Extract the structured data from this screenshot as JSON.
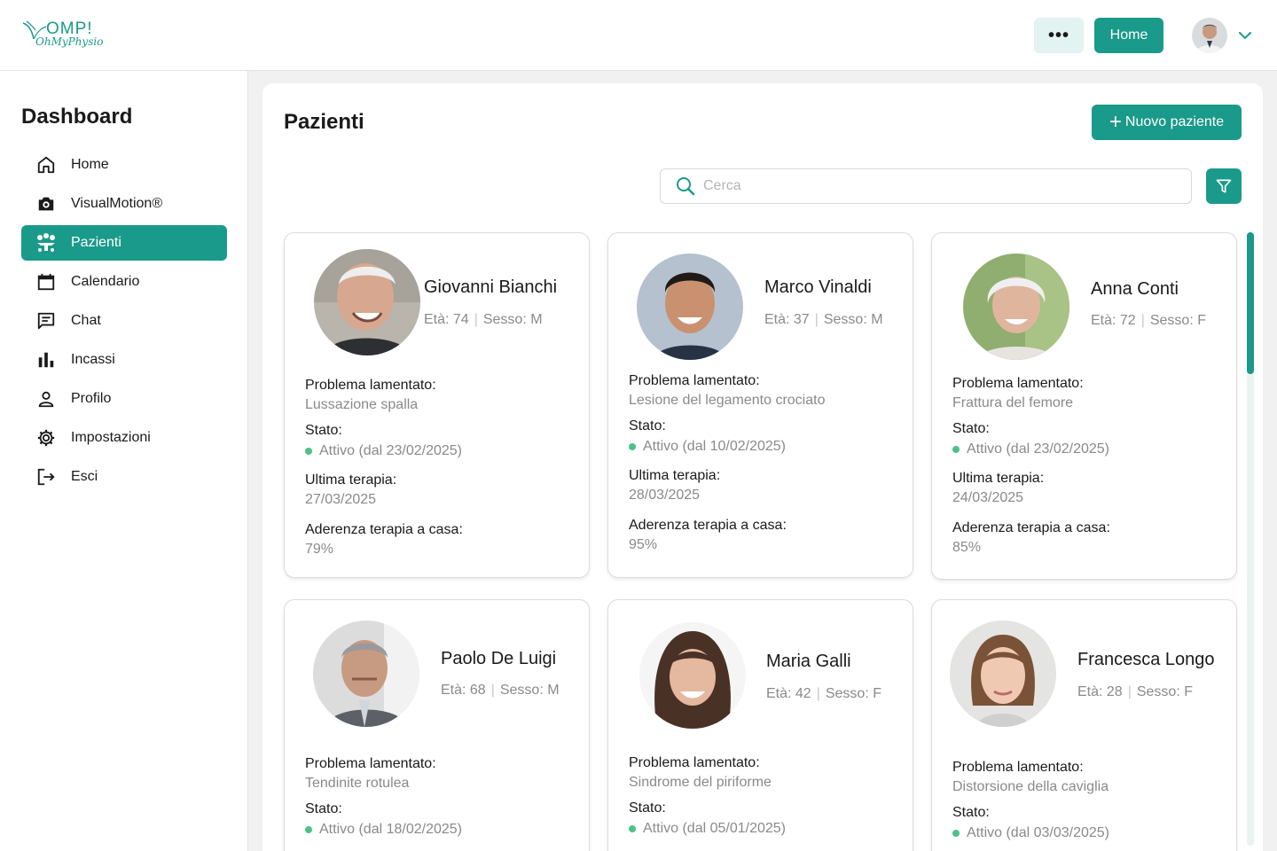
{
  "app": {
    "logo_brand": "OMP!",
    "logo_sub": "OhMyPhysio",
    "more_label": "•••",
    "home_button": "Home"
  },
  "sidebar": {
    "title": "Dashboard",
    "items": [
      {
        "label": "Home",
        "icon": "home-icon"
      },
      {
        "label": "VisualMotion®",
        "icon": "camera-icon"
      },
      {
        "label": "Pazienti",
        "icon": "patients-icon",
        "active": true
      },
      {
        "label": "Calendario",
        "icon": "calendar-icon"
      },
      {
        "label": "Chat",
        "icon": "chat-icon"
      },
      {
        "label": "Incassi",
        "icon": "bar-chart-icon"
      },
      {
        "label": "Profilo",
        "icon": "user-icon"
      },
      {
        "label": "Impostazioni",
        "icon": "gear-icon"
      },
      {
        "label": "Esci",
        "icon": "logout-icon"
      }
    ]
  },
  "main": {
    "title": "Pazienti",
    "new_button": "Nuovo paziente",
    "search_placeholder": "Cerca"
  },
  "labels": {
    "problem": "Problema lamentato:",
    "status": "Stato:",
    "last_therapy": "Ultima terapia:",
    "adherence": "Aderenza terapia a casa:"
  },
  "patients": [
    {
      "name": "Giovanni Bianchi",
      "age": "Età: 74",
      "sex": "Sesso: M",
      "problem": "Lussazione spalla",
      "status": "Attivo (dal 23/02/2025)",
      "last_therapy": "27/03/2025",
      "adherence": "79%"
    },
    {
      "name": "Marco Vinaldi",
      "age": "Età: 37",
      "sex": "Sesso: M",
      "problem": "Lesione del legamento crociato",
      "status": "Attivo (dal 10/02/2025)",
      "last_therapy": "28/03/2025",
      "adherence": "95%"
    },
    {
      "name": "Anna Conti",
      "age": "Età: 72",
      "sex": "Sesso: F",
      "problem": "Frattura del femore",
      "status": "Attivo (dal 23/02/2025)",
      "last_therapy": "24/03/2025",
      "adherence": "85%"
    },
    {
      "name": "Paolo De Luigi",
      "age": "Età: 68",
      "sex": "Sesso: M",
      "problem": "Tendinite rotulea",
      "status": "Attivo (dal 18/02/2025)"
    },
    {
      "name": "Maria Galli",
      "age": "Età: 42",
      "sex": "Sesso: F",
      "problem": "Sindrome del piriforme",
      "status": "Attivo (dal 05/01/2025)"
    },
    {
      "name": "Francesca Longo",
      "age": "Età: 28",
      "sex": "Sesso: F",
      "problem": "Distorsione della caviglia",
      "status": "Attivo (dal 03/03/2025)"
    }
  ],
  "colors": {
    "accent": "#1a9a8a",
    "status_active": "#4cc286"
  }
}
